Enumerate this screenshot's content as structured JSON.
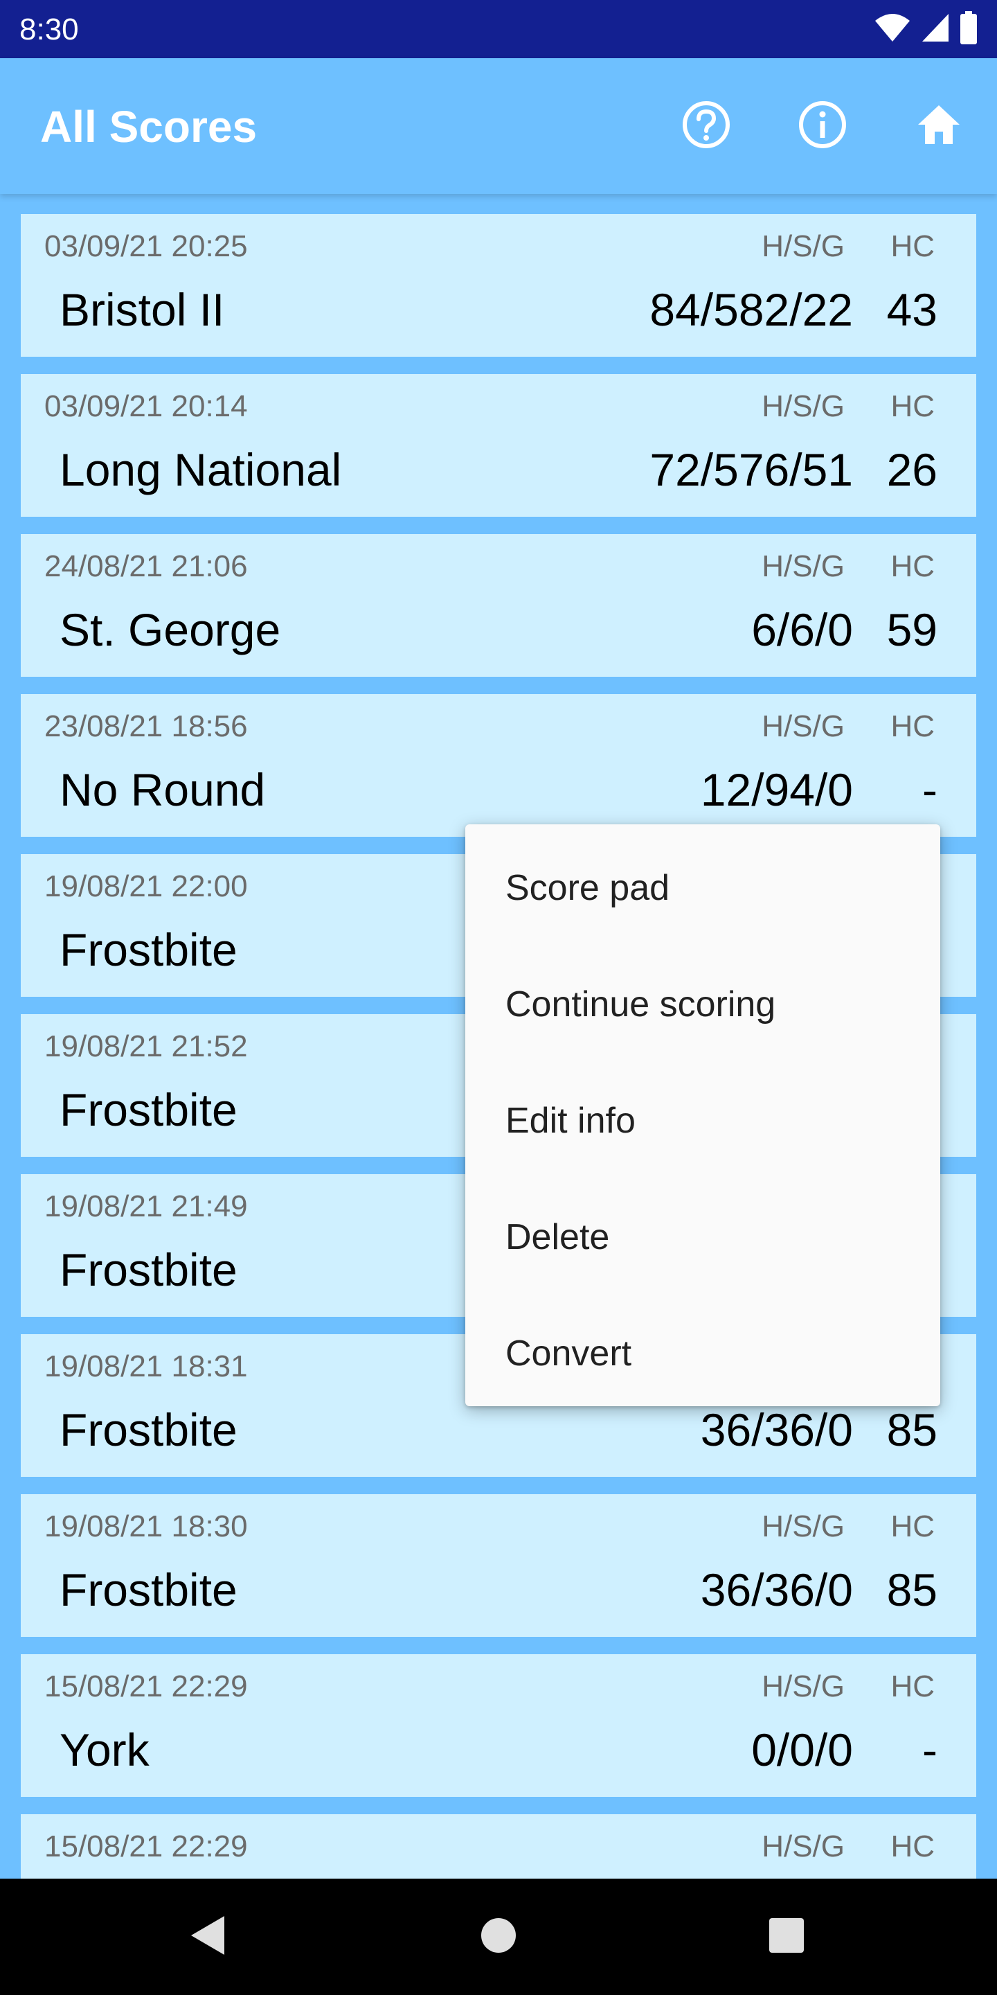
{
  "status_bar": {
    "time": "8:30",
    "icons": [
      "wifi-icon",
      "signal-icon",
      "battery-icon"
    ]
  },
  "app_bar": {
    "title": "All Scores",
    "actions": [
      "help-icon",
      "info-icon",
      "home-icon"
    ]
  },
  "labels": {
    "hsg": "H/S/G",
    "hc": "HC"
  },
  "scores": [
    {
      "date": "03/09/21 20:25",
      "round": "Bristol II",
      "score": "84/582/22",
      "hc": "43"
    },
    {
      "date": "03/09/21 20:14",
      "round": "Long National",
      "score": "72/576/51",
      "hc": "26"
    },
    {
      "date": "24/08/21 21:06",
      "round": "St. George",
      "score": "6/6/0",
      "hc": "59"
    },
    {
      "date": "23/08/21 18:56",
      "round": "No Round",
      "score": "12/94/0",
      "hc": "-"
    },
    {
      "date": "19/08/21 22:00",
      "round": "Frostbite",
      "score": "",
      "hc": ""
    },
    {
      "date": "19/08/21 21:52",
      "round": "Frostbite",
      "score": "",
      "hc": ""
    },
    {
      "date": "19/08/21 21:49",
      "round": "Frostbite",
      "score": "",
      "hc": ""
    },
    {
      "date": "19/08/21 18:31",
      "round": "Frostbite",
      "score": "36/36/0",
      "hc": "85"
    },
    {
      "date": "19/08/21 18:30",
      "round": "Frostbite",
      "score": "36/36/0",
      "hc": "85"
    },
    {
      "date": "15/08/21 22:29",
      "round": "York",
      "score": "0/0/0",
      "hc": "-"
    },
    {
      "date": "15/08/21 22:29",
      "round": "",
      "score": "",
      "hc": ""
    }
  ],
  "context_menu": {
    "items": [
      "Score pad",
      "Continue scoring",
      "Edit info",
      "Delete",
      "Convert"
    ]
  },
  "colors": {
    "status_bar": "#132091",
    "app_bar": "#6ec0ff",
    "card": "#cff0ff",
    "menu": "#fafafa",
    "nav_bar": "#000000"
  },
  "nav_bar": {
    "buttons": [
      "back-icon",
      "home-circle-icon",
      "recents-icon"
    ]
  }
}
